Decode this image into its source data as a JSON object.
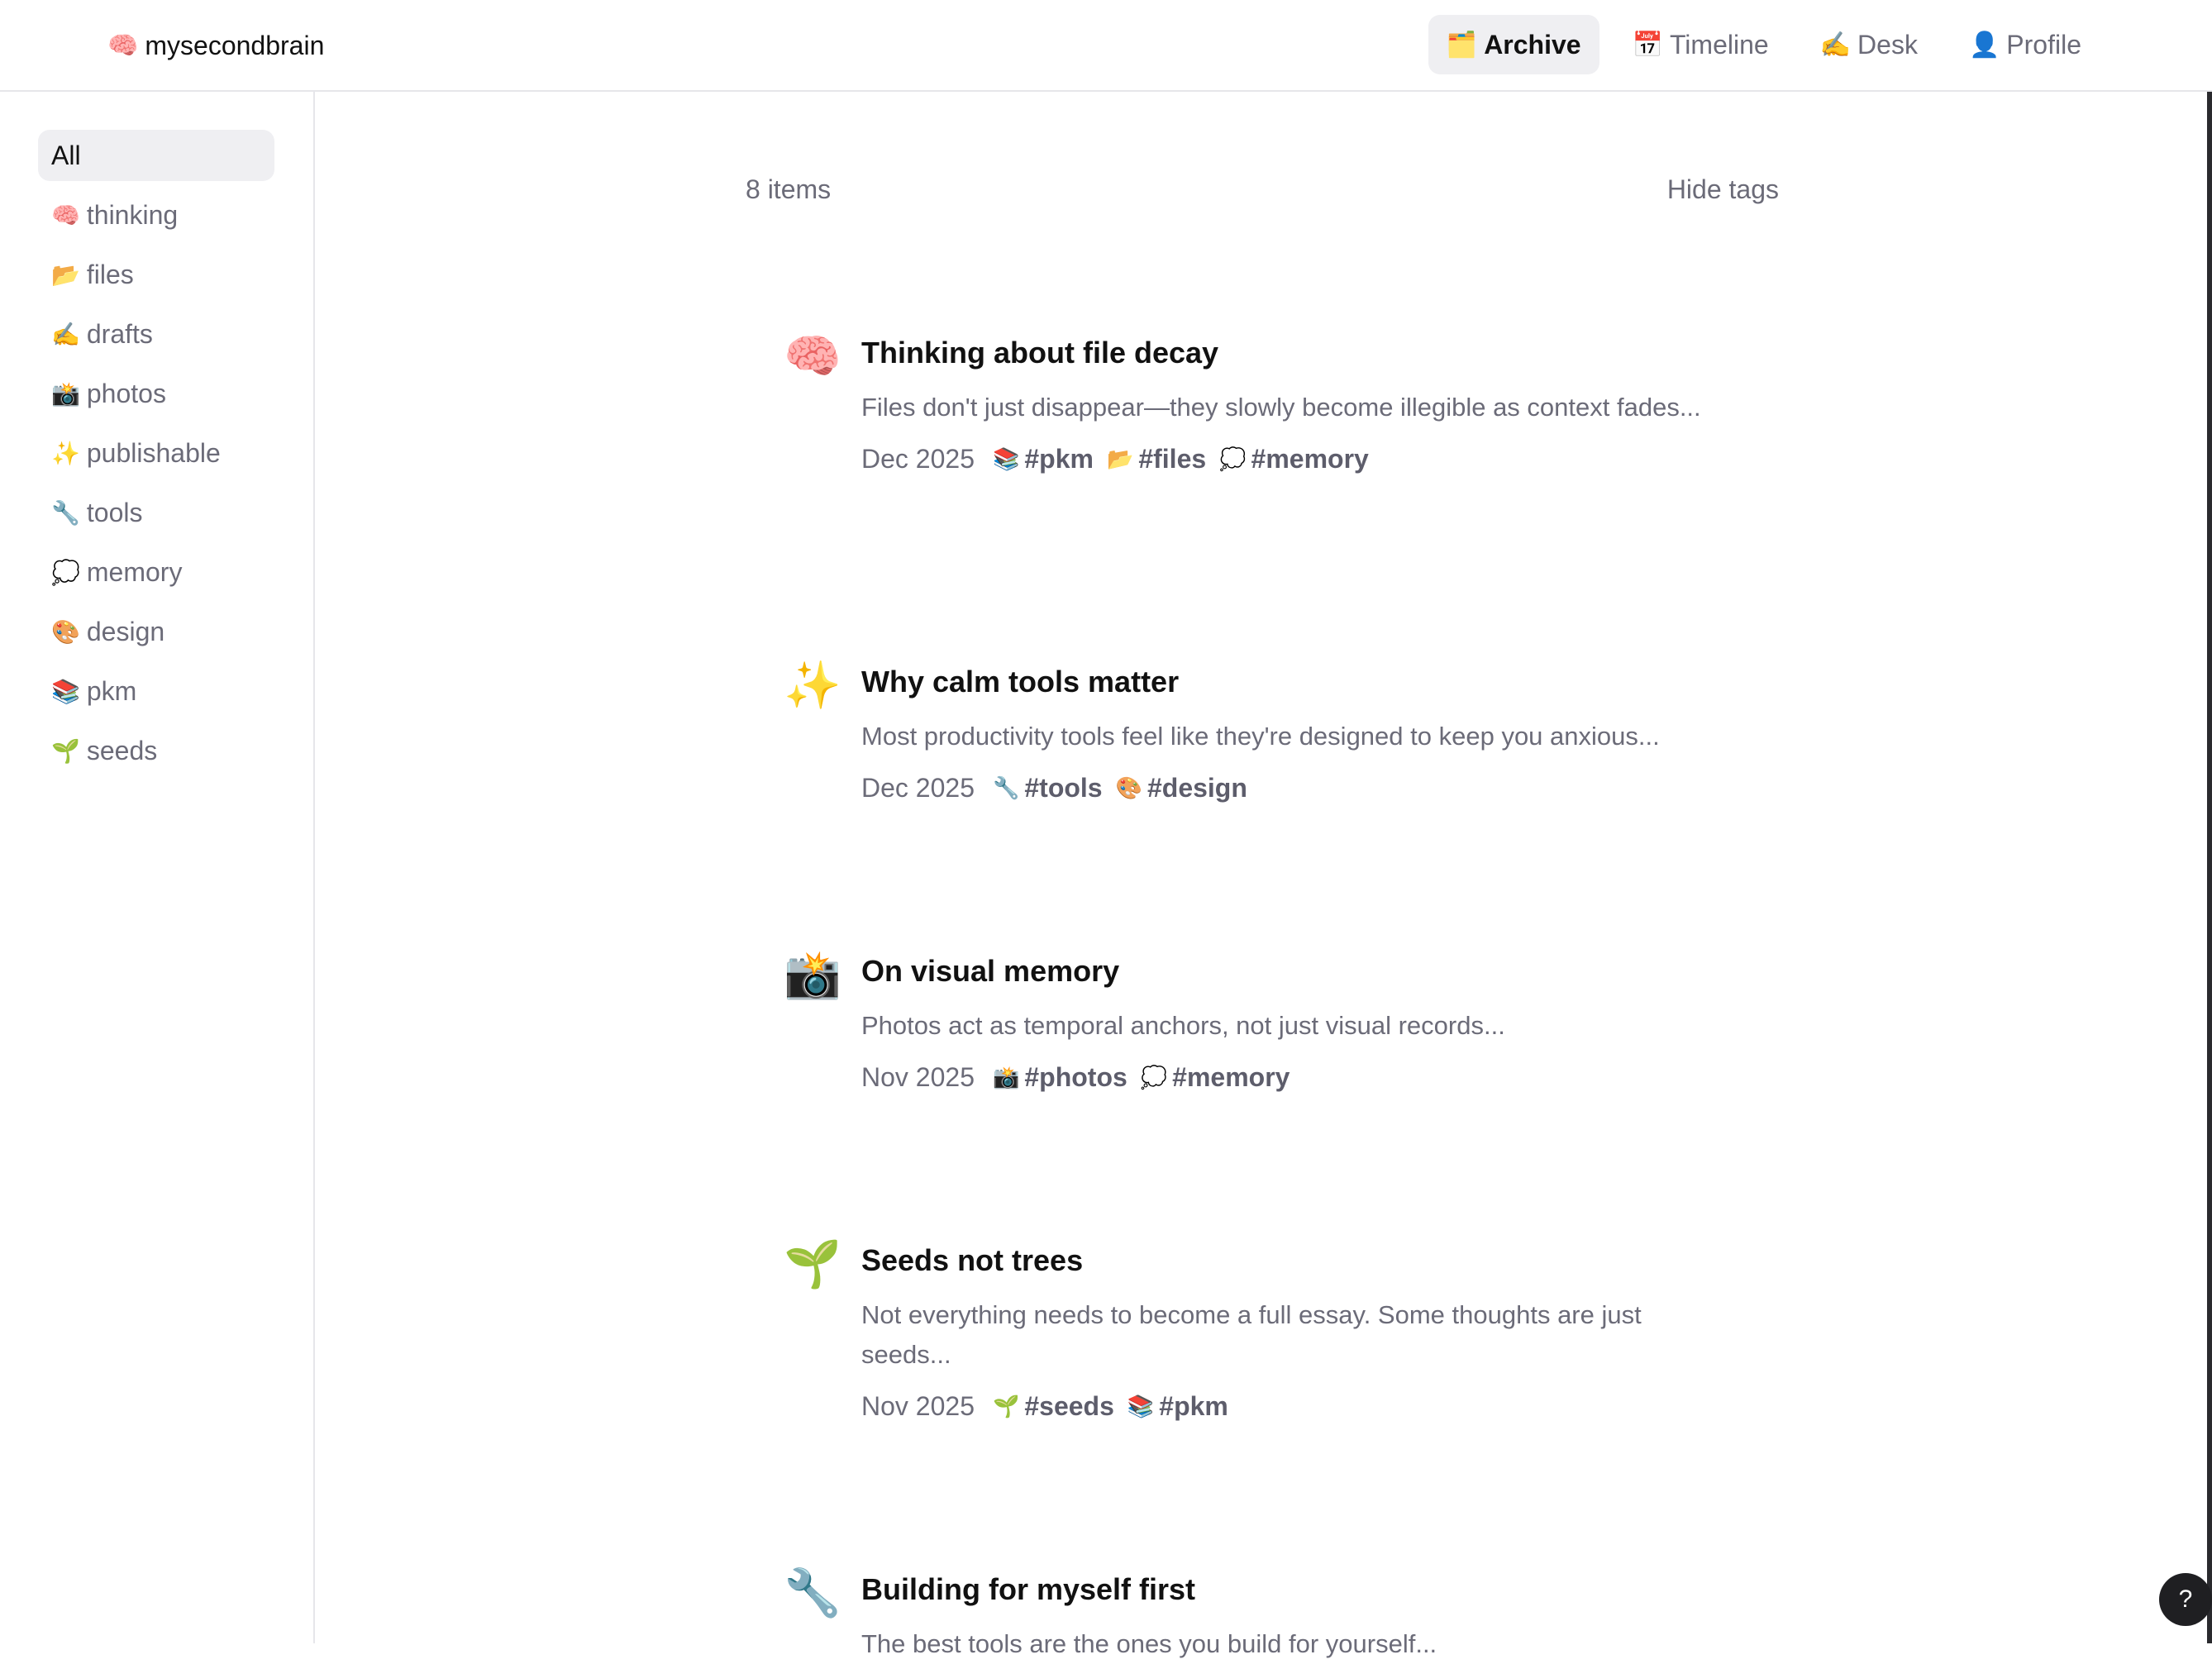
{
  "app": {
    "brand_emoji": "🧠",
    "brand": "mysecondbrain"
  },
  "topnav": [
    {
      "emoji": "🗂️",
      "label": "Archive",
      "active": true
    },
    {
      "emoji": "📅",
      "label": "Timeline",
      "active": false
    },
    {
      "emoji": "✍️",
      "label": "Desk",
      "active": false
    },
    {
      "emoji": "👤",
      "label": "Profile",
      "active": false
    }
  ],
  "sidebar": {
    "items": [
      {
        "emoji": "",
        "label": "All",
        "active": true
      },
      {
        "emoji": "🧠",
        "label": "thinking"
      },
      {
        "emoji": "📂",
        "label": "files"
      },
      {
        "emoji": "✍️",
        "label": "drafts"
      },
      {
        "emoji": "📸",
        "label": "photos"
      },
      {
        "emoji": "✨",
        "label": "publishable"
      },
      {
        "emoji": "🔧",
        "label": "tools"
      },
      {
        "emoji": "💭",
        "label": "memory"
      },
      {
        "emoji": "🎨",
        "label": "design"
      },
      {
        "emoji": "📚",
        "label": "pkm"
      },
      {
        "emoji": "🌱",
        "label": "seeds"
      }
    ]
  },
  "list": {
    "count_label": "8 items",
    "hide_tags_label": "Hide tags",
    "items": [
      {
        "icon": "🧠",
        "title": "Thinking about file decay",
        "excerpt": "Files don't just disappear—they slowly become illegible as context fades...",
        "date": "Dec 2025",
        "tags": [
          {
            "emoji": "📚",
            "label": "#pkm"
          },
          {
            "emoji": "📂",
            "label": "#files"
          },
          {
            "emoji": "💭",
            "label": "#memory"
          }
        ]
      },
      {
        "icon": "✨",
        "title": "Why calm tools matter",
        "excerpt": "Most productivity tools feel like they're designed to keep you anxious...",
        "date": "Dec 2025",
        "tags": [
          {
            "emoji": "🔧",
            "label": "#tools"
          },
          {
            "emoji": "🎨",
            "label": "#design"
          }
        ]
      },
      {
        "icon": "📸",
        "title": "On visual memory",
        "excerpt": "Photos act as temporal anchors, not just visual records...",
        "date": "Nov 2025",
        "tags": [
          {
            "emoji": "📸",
            "label": "#photos"
          },
          {
            "emoji": "💭",
            "label": "#memory"
          }
        ]
      },
      {
        "icon": "🌱",
        "title": "Seeds not trees",
        "excerpt": "Not everything needs to become a full essay. Some thoughts are just seeds...",
        "date": "Nov 2025",
        "tags": [
          {
            "emoji": "🌱",
            "label": "#seeds"
          },
          {
            "emoji": "📚",
            "label": "#pkm"
          }
        ]
      },
      {
        "icon": "🔧",
        "title": "Building for myself first",
        "excerpt": "The best tools are the ones you build for yourself...",
        "date": "",
        "tags": []
      }
    ]
  },
  "help_label": "?"
}
